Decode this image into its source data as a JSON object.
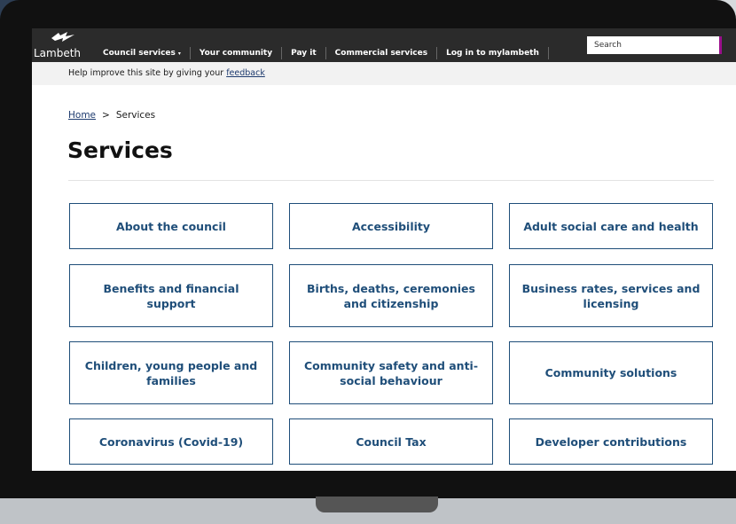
{
  "nav": {
    "logo": "Lambeth",
    "items": [
      {
        "label": "Council services",
        "caret": "▾"
      },
      {
        "label": "Your community"
      },
      {
        "label": "Pay it"
      },
      {
        "label": "Commercial services"
      },
      {
        "label": "Log in to mylambeth"
      }
    ],
    "search_placeholder": "Search"
  },
  "feedback": {
    "text": "Help improve this site by giving your ",
    "link": "feedback"
  },
  "breadcrumb": {
    "home": "Home",
    "separator": ">",
    "current": "Services"
  },
  "page_title": "Services",
  "tiles": [
    "About the council",
    "Accessibility",
    "Adult social care and health",
    "Benefits and financial support",
    "Births, deaths, ceremonies and citizenship",
    "Business rates, services and licensing",
    "Children, young people and families",
    "Community safety and anti-social behaviour",
    "Community solutions",
    "Coronavirus (Covid-19)",
    "Council Tax",
    "Developer contributions"
  ],
  "colors": {
    "tile_accent": "#1f4e79",
    "nav_bg": "#2b2b2b",
    "search_accent": "#9b0e8c"
  }
}
